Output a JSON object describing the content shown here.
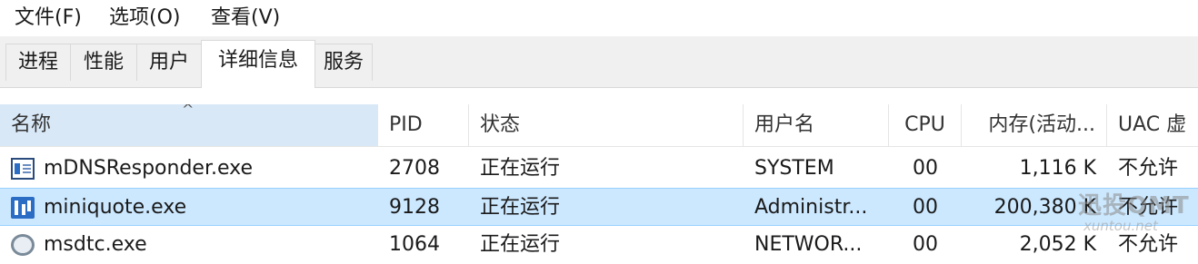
{
  "menu": {
    "file": "文件(F)",
    "options": "选项(O)",
    "view": "查看(V)"
  },
  "tabs": [
    {
      "label": "进程",
      "active": false
    },
    {
      "label": "性能",
      "active": false
    },
    {
      "label": "用户",
      "active": false
    },
    {
      "label": "详细信息",
      "active": true
    },
    {
      "label": "服务",
      "active": false
    }
  ],
  "columns": {
    "name": "名称",
    "pid": "PID",
    "status": "状态",
    "user": "用户名",
    "cpu": "CPU",
    "memory": "内存(活动...",
    "uac": "UAC 虚"
  },
  "rows": [
    {
      "icon": "window-app-icon",
      "name": "mDNSResponder.exe",
      "pid": "2708",
      "status": "正在运行",
      "user": "SYSTEM",
      "cpu": "00",
      "memory": "1,116 K",
      "uac": "不允许",
      "selected": false
    },
    {
      "icon": "chart-app-icon",
      "name": "miniquote.exe",
      "pid": "9128",
      "status": "正在运行",
      "user": "Administr...",
      "cpu": "00",
      "memory": "200,380 K",
      "uac": "不允许",
      "selected": true
    },
    {
      "icon": "gear-service-icon",
      "name": "msdtc.exe",
      "pid": "1064",
      "status": "正在运行",
      "user": "NETWOR...",
      "cpu": "00",
      "memory": "2,052 K",
      "uac": "不允许",
      "selected": false
    }
  ],
  "watermark": {
    "main": "迅投QMT",
    "sub": "xuntou.net"
  },
  "colors": {
    "selected_row": "#cce8ff",
    "sorted_header": "#d9e8f7",
    "tab_strip": "#f0f0f0"
  }
}
